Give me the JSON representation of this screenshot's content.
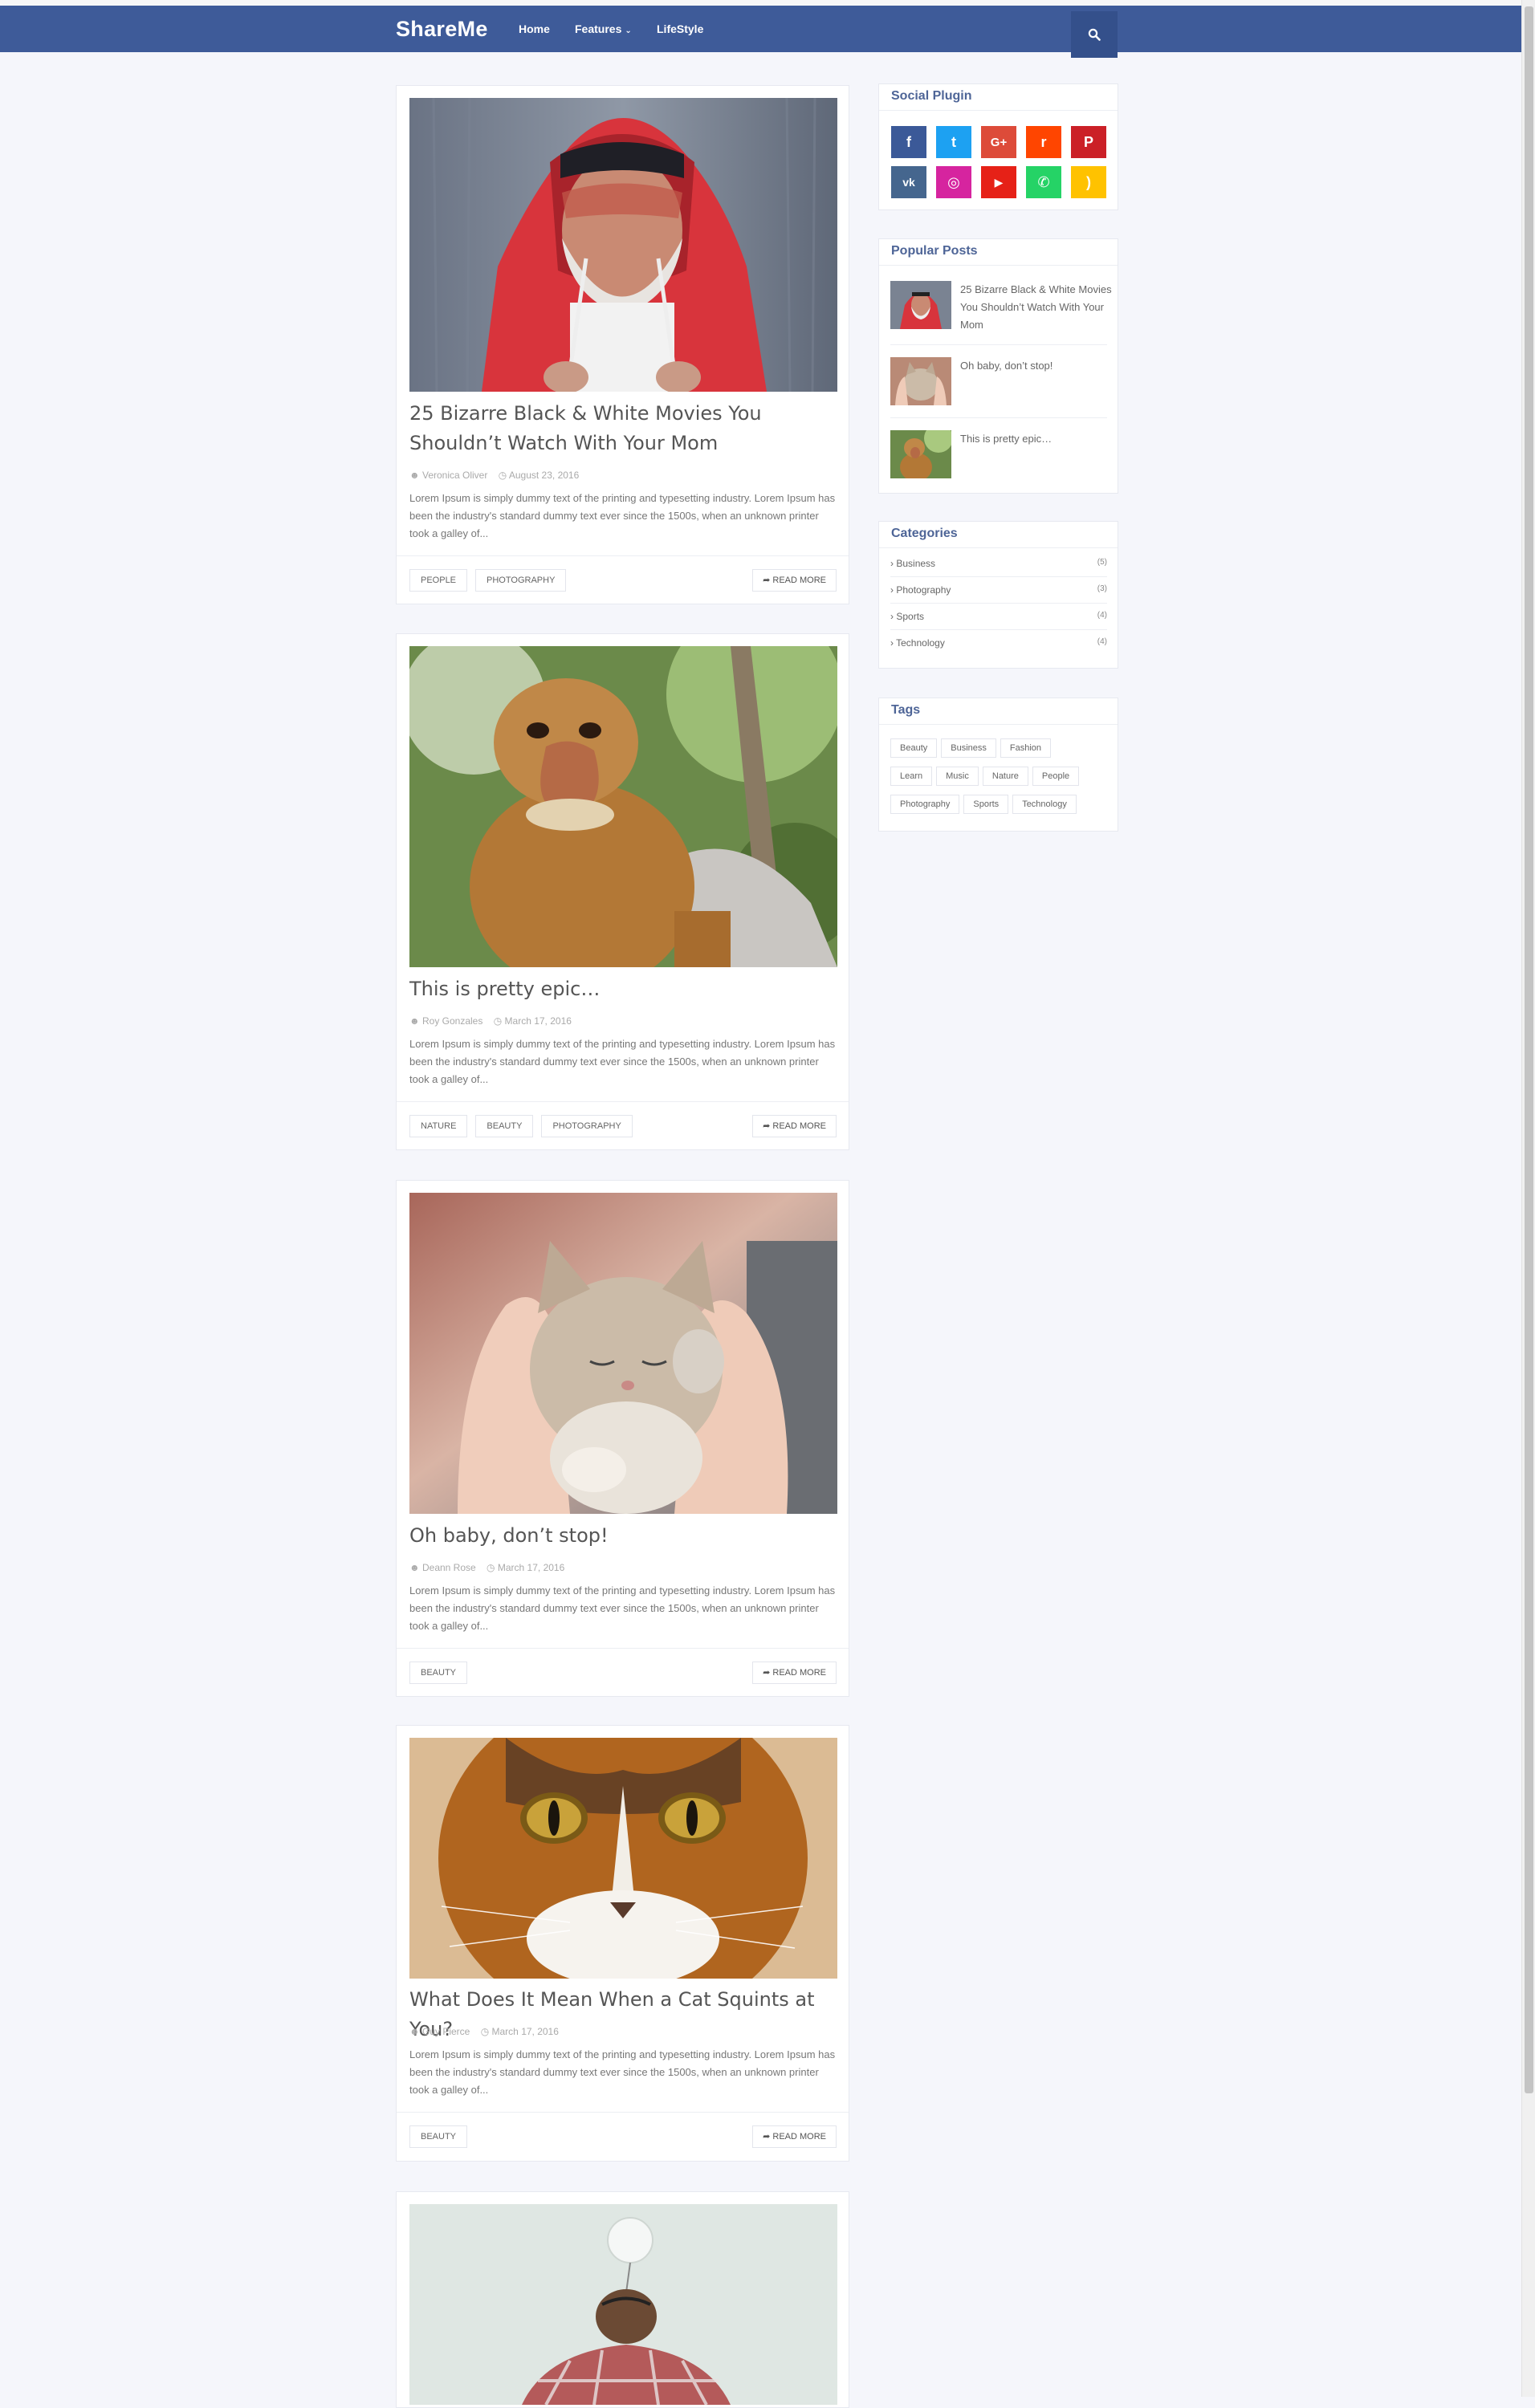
{
  "header": {
    "logo": "ShareMe",
    "nav": [
      {
        "label": "Home"
      },
      {
        "label": "Features"
      },
      {
        "label": "LifeStyle"
      }
    ]
  },
  "posts": [
    {
      "title": "25 Bizarre Black & White Movies You Shouldn’t Watch With Your Mom",
      "author": "Veronica Oliver",
      "date": "August 23, 2016",
      "excerpt": "Lorem Ipsum is simply dummy text of the printing and typesetting industry. Lorem Ipsum has been the industry's standard dummy text ever since the 1500s, when an unknown printer took a galley of...",
      "tags": [
        "PEOPLE",
        "PHOTOGRAPHY"
      ],
      "read_more": "READ MORE"
    },
    {
      "title": "This is pretty epic…",
      "author": "Roy Gonzales",
      "date": "March 17, 2016",
      "excerpt": "Lorem Ipsum is simply dummy text of the printing and typesetting industry. Lorem Ipsum has been the industry's standard dummy text ever since the 1500s, when an unknown printer took a galley of...",
      "tags": [
        "NATURE",
        "BEAUTY",
        "PHOTOGRAPHY"
      ],
      "read_more": "READ MORE"
    },
    {
      "title": "Oh baby, don’t stop!",
      "author": "Deann Rose",
      "date": "March 17, 2016",
      "excerpt": "Lorem Ipsum is simply dummy text of the printing and typesetting industry. Lorem Ipsum has been the industry's standard dummy text ever since the 1500s, when an unknown printer took a galley of...",
      "tags": [
        "BEAUTY"
      ],
      "read_more": "READ MORE"
    },
    {
      "title": "What Does It Mean When a Cat Squints at You?",
      "author": "Guy Pierce",
      "date": "March 17, 2016",
      "excerpt": "Lorem Ipsum is simply dummy text of the printing and typesetting industry. Lorem Ipsum has been the industry's standard dummy text ever since the 1500s, when an unknown printer took a galley of...",
      "tags": [
        "BEAUTY"
      ],
      "read_more": "READ MORE"
    }
  ],
  "sidebar": {
    "social": {
      "title": "Social Plugin",
      "buttons": [
        {
          "name": "facebook",
          "glyph": "f",
          "color": "#3b5998"
        },
        {
          "name": "twitter",
          "glyph": "t",
          "color": "#1da1f2"
        },
        {
          "name": "google-plus",
          "glyph": "G+",
          "color": "#dd4b39"
        },
        {
          "name": "reddit",
          "glyph": "r",
          "color": "#ff4500"
        },
        {
          "name": "pinterest",
          "glyph": "P",
          "color": "#cb2027"
        },
        {
          "name": "vk",
          "glyph": "vk",
          "color": "#45668e"
        },
        {
          "name": "instagram",
          "glyph": "◎",
          "color": "#d6249f"
        },
        {
          "name": "youtube",
          "glyph": "▶",
          "color": "#e62117"
        },
        {
          "name": "whatsapp",
          "glyph": "✆",
          "color": "#25d366"
        },
        {
          "name": "rss",
          "glyph": ")",
          "color": "#ffc200"
        }
      ]
    },
    "popular": {
      "title": "Popular Posts",
      "items": [
        {
          "title": "25 Bizarre Black & White Movies You Shouldn’t Watch With Your Mom"
        },
        {
          "title": "Oh baby, don’t stop!"
        },
        {
          "title": "This is pretty epic…"
        }
      ]
    },
    "categories": {
      "title": "Categories",
      "items": [
        {
          "name": "Business",
          "count": "(5)"
        },
        {
          "name": "Photography",
          "count": "(3)"
        },
        {
          "name": "Sports",
          "count": "(4)"
        },
        {
          "name": "Technology",
          "count": "(4)"
        }
      ]
    },
    "tags": {
      "title": "Tags",
      "items": [
        "Beauty",
        "Business",
        "Fashion",
        "Learn",
        "Music",
        "Nature",
        "People",
        "Photography",
        "Sports",
        "Technology"
      ]
    }
  },
  "colors": {
    "brand": "#3e5b99",
    "widget_title": "#4e6597",
    "page_bg": "#f5f6fb"
  }
}
